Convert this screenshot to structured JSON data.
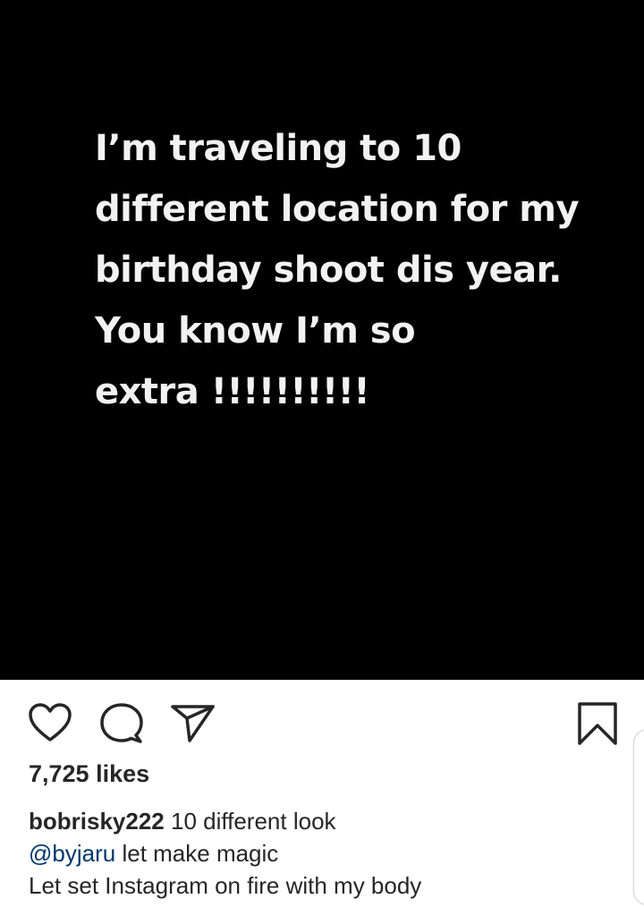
{
  "post": {
    "image_text_lines": [
      "I’m traveling to 10",
      "different location for my",
      "birthday shoot dis year.",
      "You know I’m so",
      "extra !!!!!!!!!!"
    ],
    "background_color": "#000000",
    "text_color": "#f2f2f2"
  },
  "actions": {
    "like_icon": "heart-outline-icon",
    "comment_icon": "speech-bubble-icon",
    "share_icon": "paper-plane-icon",
    "save_icon": "bookmark-outline-icon"
  },
  "likes": "7,725 likes",
  "caption": {
    "username": "bobrisky222",
    "text": "10 different look",
    "mention": "@byjaru",
    "mention_text": "let make magic",
    "line3": "Let set Instagram on fire with my body"
  },
  "colors": {
    "text": "#262626",
    "mention": "#00376b"
  }
}
